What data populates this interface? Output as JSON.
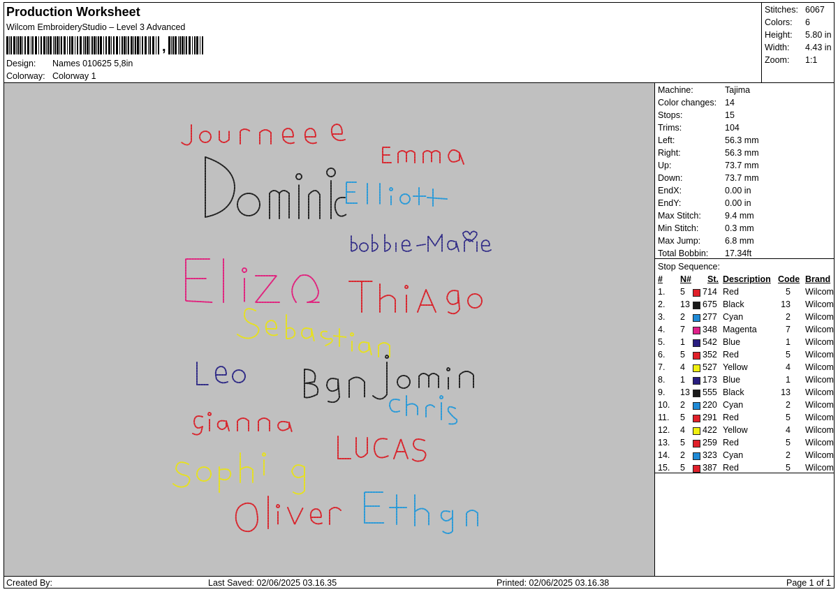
{
  "header": {
    "title": "Production Worksheet",
    "software": "Wilcom EmbroideryStudio – Level 3 Advanced",
    "barcode_suffix": ",",
    "design_label": "Design:",
    "design_value": "Names 010625 5,8in",
    "colorway_label": "Colorway:",
    "colorway_value": "Colorway 1"
  },
  "stats": {
    "stitches_label": "Stitches:",
    "stitches": "6067",
    "colors_label": "Colors:",
    "colors": "6",
    "height_label": "Height:",
    "height": "5.80 in",
    "width_label": "Width:",
    "width": "4.43 in",
    "zoom_label": "Zoom:",
    "zoom": "1:1"
  },
  "machine": {
    "rows": [
      {
        "label": "Machine:",
        "value": "Tajima"
      },
      {
        "label": "Color changes:",
        "value": "14"
      },
      {
        "label": "Stops:",
        "value": "15"
      },
      {
        "label": "Trims:",
        "value": "104"
      },
      {
        "label": "Left:",
        "value": "56.3 mm"
      },
      {
        "label": "Right:",
        "value": "56.3 mm"
      },
      {
        "label": "Up:",
        "value": "73.7 mm"
      },
      {
        "label": "Down:",
        "value": "73.7 mm"
      },
      {
        "label": "EndX:",
        "value": "0.00 in"
      },
      {
        "label": "EndY:",
        "value": "0.00 in"
      },
      {
        "label": "Max Stitch:",
        "value": "9.4 mm"
      },
      {
        "label": "Min Stitch:",
        "value": "0.3 mm"
      },
      {
        "label": "Max Jump:",
        "value": "6.8 mm"
      },
      {
        "label": "Total Bobbin:",
        "value": "17.34ft"
      }
    ]
  },
  "stop_sequence": {
    "heading": "Stop Sequence:",
    "columns": {
      "num": "#",
      "needle": "N#",
      "stitches": "St.",
      "description": "Description",
      "code": "Code",
      "brand": "Brand"
    },
    "rows": [
      {
        "num": "1.",
        "needle": "5",
        "color": "#e0202a",
        "stitches": "714",
        "description": "Red",
        "code": "5",
        "brand": "Wilcom"
      },
      {
        "num": "2.",
        "needle": "13",
        "color": "#1a1a1a",
        "stitches": "675",
        "description": "Black",
        "code": "13",
        "brand": "Wilcom"
      },
      {
        "num": "3.",
        "needle": "2",
        "color": "#1f8ad6",
        "stitches": "277",
        "description": "Cyan",
        "code": "2",
        "brand": "Wilcom"
      },
      {
        "num": "4.",
        "needle": "7",
        "color": "#e0208a",
        "stitches": "348",
        "description": "Magenta",
        "code": "7",
        "brand": "Wilcom"
      },
      {
        "num": "5.",
        "needle": "1",
        "color": "#2a1e80",
        "stitches": "542",
        "description": "Blue",
        "code": "1",
        "brand": "Wilcom"
      },
      {
        "num": "6.",
        "needle": "5",
        "color": "#e0202a",
        "stitches": "352",
        "description": "Red",
        "code": "5",
        "brand": "Wilcom"
      },
      {
        "num": "7.",
        "needle": "4",
        "color": "#f0f010",
        "stitches": "527",
        "description": "Yellow",
        "code": "4",
        "brand": "Wilcom"
      },
      {
        "num": "8.",
        "needle": "1",
        "color": "#2a1e80",
        "stitches": "173",
        "description": "Blue",
        "code": "1",
        "brand": "Wilcom"
      },
      {
        "num": "9.",
        "needle": "13",
        "color": "#1a1a1a",
        "stitches": "555",
        "description": "Black",
        "code": "13",
        "brand": "Wilcom"
      },
      {
        "num": "10.",
        "needle": "2",
        "color": "#1f8ad6",
        "stitches": "220",
        "description": "Cyan",
        "code": "2",
        "brand": "Wilcom"
      },
      {
        "num": "11.",
        "needle": "5",
        "color": "#e0202a",
        "stitches": "291",
        "description": "Red",
        "code": "5",
        "brand": "Wilcom"
      },
      {
        "num": "12.",
        "needle": "4",
        "color": "#f0f010",
        "stitches": "422",
        "description": "Yellow",
        "code": "4",
        "brand": "Wilcom"
      },
      {
        "num": "13.",
        "needle": "5",
        "color": "#e0202a",
        "stitches": "259",
        "description": "Red",
        "code": "5",
        "brand": "Wilcom"
      },
      {
        "num": "14.",
        "needle": "2",
        "color": "#1f8ad6",
        "stitches": "323",
        "description": "Cyan",
        "code": "2",
        "brand": "Wilcom"
      },
      {
        "num": "15.",
        "needle": "5",
        "color": "#e0202a",
        "stitches": "387",
        "description": "Red",
        "code": "5",
        "brand": "Wilcom"
      }
    ]
  },
  "design_names": [
    {
      "text": "Journee",
      "color": "#d8262e"
    },
    {
      "text": "Emma",
      "color": "#d8262e"
    },
    {
      "text": "Dominic",
      "color": "#222222"
    },
    {
      "text": "Elliott",
      "color": "#2a9ad8"
    },
    {
      "text": "Bobbie-Marie",
      "color": "#2f2a86"
    },
    {
      "text": "Eliza",
      "color": "#e0247e"
    },
    {
      "text": "Thiago",
      "color": "#d8262e"
    },
    {
      "text": "Sebastian",
      "color": "#e6e020"
    },
    {
      "text": "Leo",
      "color": "#2f2a86"
    },
    {
      "text": "Benjamin",
      "color": "#222222"
    },
    {
      "text": "Chris",
      "color": "#2a9ad8"
    },
    {
      "text": "Gianna",
      "color": "#d8262e"
    },
    {
      "text": "LUCAS",
      "color": "#d8262e"
    },
    {
      "text": "Sophia",
      "color": "#e6e020"
    },
    {
      "text": "Oliver",
      "color": "#d8262e"
    },
    {
      "text": "Ethan",
      "color": "#2a9ad8"
    }
  ],
  "canvas": {
    "background": "#c0c0c0"
  },
  "footer": {
    "created_by": "Created By:",
    "last_saved": "Last Saved: 02/06/2025 03.16.35",
    "printed": "Printed: 02/06/2025 03.16.38",
    "page": "Page 1 of 1"
  }
}
